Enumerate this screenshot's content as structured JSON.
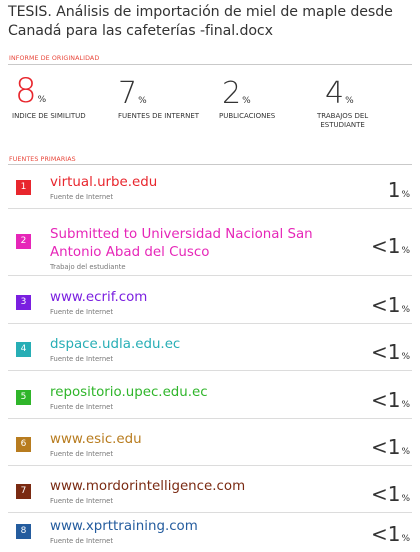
{
  "document": {
    "title": "TESIS. Análisis de importación de miel de maple desde Canadá para las cafeterías -final.docx"
  },
  "originality": {
    "section_label": "INFORME DE ORIGINALIDAD",
    "similarity": {
      "value": "8",
      "unit": "%",
      "label": "INDICE DE SIMILITUD"
    },
    "internet": {
      "value": "7",
      "unit": "%",
      "label": "FUENTES DE INTERNET"
    },
    "publications": {
      "value": "2",
      "unit": "%",
      "label": "PUBLICACIONES"
    },
    "student": {
      "value": "4",
      "unit": "%",
      "label_line1": "TRABAJOS DEL",
      "label_line2": "ESTUDIANTE"
    }
  },
  "primary_sources": {
    "section_label": "FUENTES PRIMARIAS",
    "items": [
      {
        "num": "1",
        "name": "virtual.urbe.edu",
        "name2": "",
        "kind": "Fuente de Internet",
        "value": "1",
        "unit": "%",
        "color": "#e8262d"
      },
      {
        "num": "2",
        "name": "Submitted to Universidad Nacional San",
        "name2": "Antonio Abad del Cusco",
        "kind": "Trabajo del estudiante",
        "value": "<1",
        "unit": "%",
        "color": "#e626b8"
      },
      {
        "num": "3",
        "name": "www.ecrif.com",
        "name2": "",
        "kind": "Fuente de Internet",
        "value": "<1",
        "unit": "%",
        "color": "#7a1fe0"
      },
      {
        "num": "4",
        "name": "dspace.udla.edu.ec",
        "name2": "",
        "kind": "Fuente de Internet",
        "value": "<1",
        "unit": "%",
        "color": "#27aeb5"
      },
      {
        "num": "5",
        "name": "repositorio.upec.edu.ec",
        "name2": "",
        "kind": "Fuente de Internet",
        "value": "<1",
        "unit": "%",
        "color": "#2fb52a"
      },
      {
        "num": "6",
        "name": "www.esic.edu",
        "name2": "",
        "kind": "Fuente de Internet",
        "value": "<1",
        "unit": "%",
        "color": "#b87c1f"
      },
      {
        "num": "7",
        "name": "www.mordorintelligence.com",
        "name2": "",
        "kind": "Fuente de Internet",
        "value": "<1",
        "unit": "%",
        "color": "#7a2a12"
      },
      {
        "num": "8",
        "name": "www.xprttraining.com",
        "name2": "",
        "kind": "Fuente de Internet",
        "value": "<1",
        "unit": "%",
        "color": "#245c9e"
      }
    ]
  }
}
